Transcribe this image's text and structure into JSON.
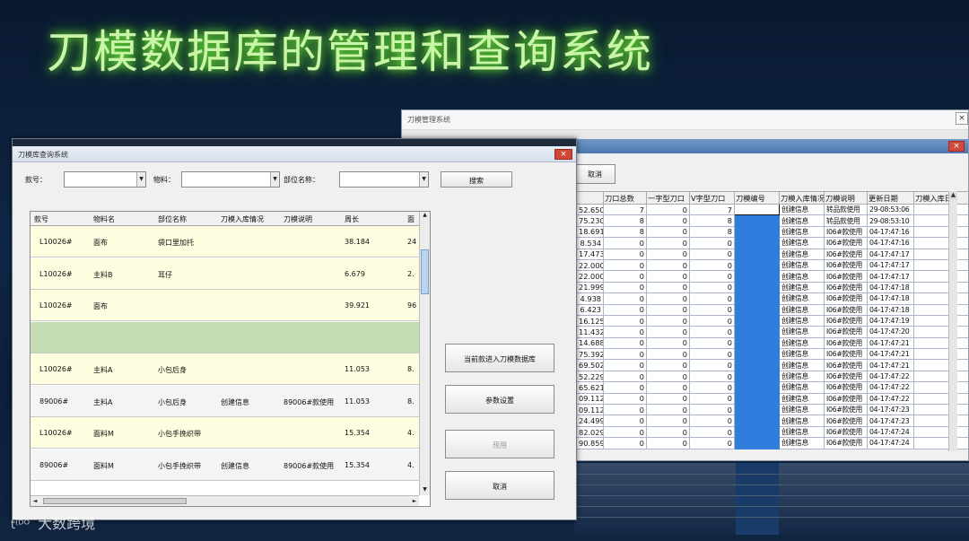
{
  "slide": {
    "title": "刀模数据库的管理和查询系统"
  },
  "watermark": {
    "logo_text": "​t⁽ᴰᴼ",
    "text": "大数跨境"
  },
  "back_window": {
    "title": "刀模管理系统",
    "cancel_label": "取消",
    "columns": [
      "刀口总数",
      "一字型刀口",
      "V字型刀口",
      "刀模编号",
      "刀模入库情况",
      "刀模说明",
      "更新日期",
      "刀模入库日"
    ],
    "rows": [
      {
        "c0": "52.650",
        "c1": "7",
        "c2": "0",
        "c3": "7",
        "c5": "创建信息",
        "c6": "转品款使用",
        "c7": "29-08:53:06"
      },
      {
        "c0": "75.230",
        "c1": "8",
        "c2": "0",
        "c3": "8",
        "c5": "创建信息",
        "c6": "转品款使用",
        "c7": "29-08:53:10"
      },
      {
        "c0": "18.691",
        "c1": "8",
        "c2": "0",
        "c3": "8",
        "c5": "创建信息",
        "c6": "I06#款使用",
        "c7": "04-17:47:16"
      },
      {
        "c0": "8.534",
        "c1": "0",
        "c2": "0",
        "c3": "0",
        "c5": "创建信息",
        "c6": "I06#款使用",
        "c7": "04-17:47:16"
      },
      {
        "c0": "17.473",
        "c1": "0",
        "c2": "0",
        "c3": "0",
        "c5": "创建信息",
        "c6": "I06#款使用",
        "c7": "04-17:47:17"
      },
      {
        "c0": "22.000",
        "c1": "0",
        "c2": "0",
        "c3": "0",
        "c5": "创建信息",
        "c6": "I06#款使用",
        "c7": "04-17:47:17"
      },
      {
        "c0": "22.000",
        "c1": "0",
        "c2": "0",
        "c3": "0",
        "c5": "创建信息",
        "c6": "I06#款使用",
        "c7": "04-17:47:17"
      },
      {
        "c0": "21.999",
        "c1": "0",
        "c2": "0",
        "c3": "0",
        "c5": "创建信息",
        "c6": "I06#款使用",
        "c7": "04-17:47:18"
      },
      {
        "c0": "4.938",
        "c1": "0",
        "c2": "0",
        "c3": "0",
        "c5": "创建信息",
        "c6": "I06#款使用",
        "c7": "04-17:47:18"
      },
      {
        "c0": "6.423",
        "c1": "0",
        "c2": "0",
        "c3": "0",
        "c5": "创建信息",
        "c6": "I06#款使用",
        "c7": "04-17:47:18"
      },
      {
        "c0": "16.125",
        "c1": "0",
        "c2": "0",
        "c3": "0",
        "c5": "创建信息",
        "c6": "I06#款使用",
        "c7": "04-17:47:19"
      },
      {
        "c0": "11.432",
        "c1": "0",
        "c2": "0",
        "c3": "0",
        "c5": "创建信息",
        "c6": "I06#款使用",
        "c7": "04-17:47:20"
      },
      {
        "c0": "14.688",
        "c1": "0",
        "c2": "0",
        "c3": "0",
        "c5": "创建信息",
        "c6": "I06#款使用",
        "c7": "04-17:47:21"
      },
      {
        "c0": "75.392",
        "c1": "0",
        "c2": "0",
        "c3": "0",
        "c5": "创建信息",
        "c6": "I06#款使用",
        "c7": "04-17:47:21"
      },
      {
        "c0": "69.502",
        "c1": "0",
        "c2": "0",
        "c3": "0",
        "c5": "创建信息",
        "c6": "I06#款使用",
        "c7": "04-17:47:21"
      },
      {
        "c0": "52.229",
        "c1": "0",
        "c2": "0",
        "c3": "0",
        "c5": "创建信息",
        "c6": "I06#款使用",
        "c7": "04-17:47:22"
      },
      {
        "c0": "65.621",
        "c1": "0",
        "c2": "0",
        "c3": "0",
        "c5": "创建信息",
        "c6": "I06#款使用",
        "c7": "04-17:47:22"
      },
      {
        "c0": "09.112",
        "c1": "0",
        "c2": "0",
        "c3": "0",
        "c5": "创建信息",
        "c6": "I06#款使用",
        "c7": "04-17:47:22"
      },
      {
        "c0": "09.112",
        "c1": "0",
        "c2": "0",
        "c3": "0",
        "c5": "创建信息",
        "c6": "I06#款使用",
        "c7": "04-17:47:23"
      },
      {
        "c0": "24.499",
        "c1": "0",
        "c2": "0",
        "c3": "0",
        "c5": "创建信息",
        "c6": "I06#款使用",
        "c7": "04-17:47:23"
      },
      {
        "c0": "82.029",
        "c1": "0",
        "c2": "0",
        "c3": "0",
        "c5": "创建信息",
        "c6": "I06#款使用",
        "c7": "04-17:47:24"
      },
      {
        "c0": "90.859",
        "c1": "0",
        "c2": "0",
        "c3": "0",
        "c5": "创建信息",
        "c6": "I06#款使用",
        "c7": "04-17:47:24"
      }
    ]
  },
  "front_window": {
    "title": "刀模库查询系统",
    "filters": {
      "style_label": "款号：",
      "material_label": "物料：",
      "part_label": "部位名称：",
      "search_label": "搜索"
    },
    "columns": [
      "款号",
      "物料名",
      "部位名称",
      "刀模入库情况",
      "刀模说明",
      "周长",
      "面"
    ],
    "rows": [
      {
        "style": "L10026#",
        "material": "面布",
        "part": "袋口里加托",
        "status": "",
        "note": "",
        "perimeter": "38.184",
        "area": "24",
        "bg": "#fffde0"
      },
      {
        "style": "L10026#",
        "material": "主料B",
        "part": "耳仔",
        "status": "",
        "note": "",
        "perimeter": "6.679",
        "area": "2.",
        "bg": "#fffde0"
      },
      {
        "style": "L10026#",
        "material": "面布",
        "part": "",
        "status": "",
        "note": "",
        "perimeter": "39.921",
        "area": "96",
        "bg": "#fffde0"
      },
      {
        "style": "",
        "material": "",
        "part": "",
        "status": "",
        "note": "",
        "perimeter": "",
        "area": "",
        "bg": "#c4dcb4"
      },
      {
        "style": "L10026#",
        "material": "主料A",
        "part": "小包后身",
        "status": "",
        "note": "",
        "perimeter": "11.053",
        "area": "8.",
        "bg": "#fffde0"
      },
      {
        "style": "89006#",
        "material": "主料A",
        "part": "小包后身",
        "status": "创建信息",
        "note": "89006#款使用",
        "perimeter": "11.053",
        "area": "8.",
        "bg": "#f4f4f4"
      },
      {
        "style": "L10026#",
        "material": "面料M",
        "part": "小包手挽织带",
        "status": "",
        "note": "",
        "perimeter": "15.354",
        "area": "4.",
        "bg": "#fffde0"
      },
      {
        "style": "89006#",
        "material": "面料M",
        "part": "小包手挽织带",
        "status": "创建信息",
        "note": "89006#款使用",
        "perimeter": "15.354",
        "area": "4.",
        "bg": "#f4f4f4"
      }
    ],
    "buttons": {
      "import_label": "当前款进入刀模数据库",
      "params_label": "参数设置",
      "disabled_label": "预用",
      "cancel_label": "取消"
    }
  }
}
